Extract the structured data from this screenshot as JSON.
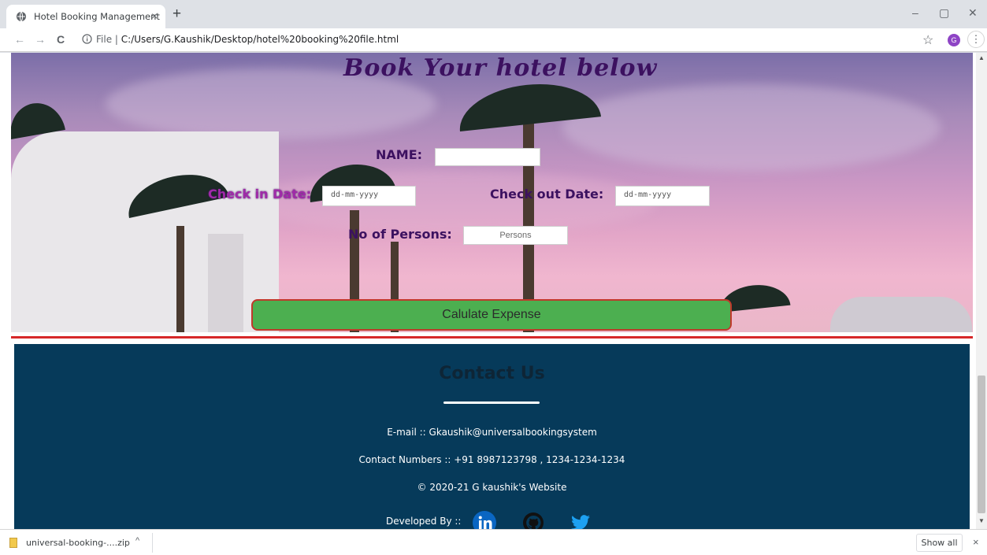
{
  "browser": {
    "tab_title": "Hotel Booking Management",
    "tab_close": "×",
    "new_tab": "+",
    "window_minimize": "–",
    "window_maximize": "▢",
    "window_close": "✕",
    "nav_back": "←",
    "nav_forward": "→",
    "nav_reload": "C",
    "address_prefix": "File  |  ",
    "address_url": "C:/Users/G.Kaushik/Desktop/hotel%20booking%20file.html",
    "bookmark_star": "☆",
    "profile_initial": "G",
    "menu": "⋮"
  },
  "page": {
    "hero_title": "Book Your hotel below",
    "name_label": "NAME:",
    "name_value": "",
    "checkin_label": "Check in Date:",
    "checkin_placeholder": "dd-mm-yyyy",
    "checkout_label": "Check out Date:",
    "checkout_placeholder": "dd-mm-yyyy",
    "persons_label": "No of Persons:",
    "persons_placeholder": "Persons",
    "calculate_button": "Calulate Expense"
  },
  "footer": {
    "title": "Contact Us",
    "email": "E-mail :: Gkaushik@universalbookingsystem",
    "phones": "Contact Numbers :: +91 8987123798 , 1234-1234-1234",
    "copyright": "© 2020-21 G kaushik's Website",
    "developed_by": "Developed By ::",
    "social_icons": [
      "linkedin-icon",
      "github-icon",
      "twitter-icon"
    ]
  },
  "download_bar": {
    "file_name": "universal-booking-....zip",
    "caret": "^",
    "show_all": "Show all",
    "close": "×"
  },
  "colors": {
    "footer_bg": "#063a5a",
    "button_green": "#4caf50",
    "divider_red": "#d62728",
    "title_purple": "#3c1160"
  }
}
